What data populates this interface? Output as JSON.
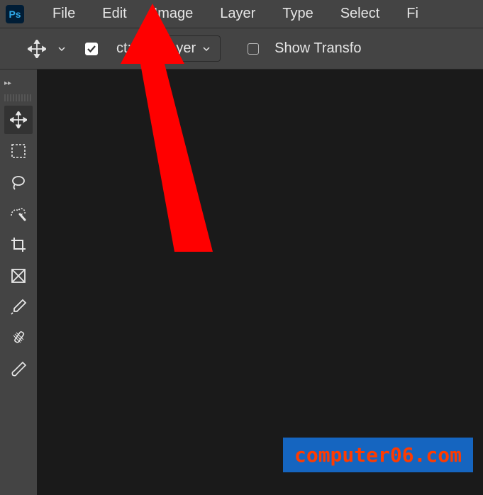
{
  "app_icon_label": "Ps",
  "menu": {
    "file": "File",
    "edit": "Edit",
    "image": "Image",
    "layer": "Layer",
    "type": "Type",
    "select": "Select",
    "fi_partial": "Fi"
  },
  "options": {
    "partial_label": "ct:",
    "select_value": "Layer",
    "show_transform_partial": "Show Transfo"
  },
  "watermark": "computer06.com"
}
